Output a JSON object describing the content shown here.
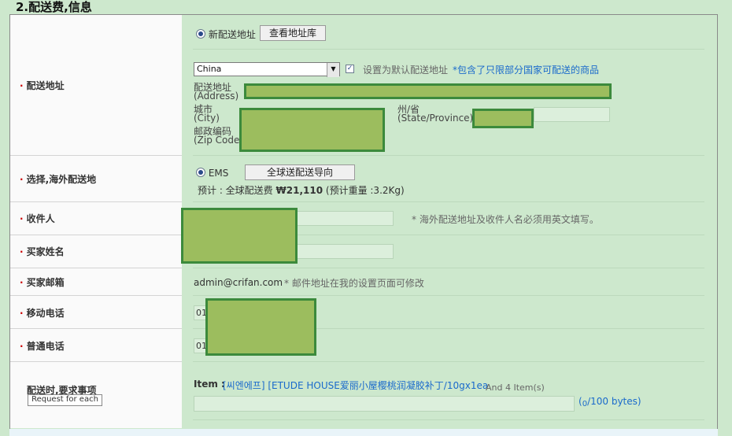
{
  "section_title": "2.配送费,信息",
  "rows": {
    "address": {
      "label": "配送地址"
    },
    "overseas": {
      "label": "选择,海外配送地"
    },
    "recipient": {
      "label": "收件人"
    },
    "buyer_name": {
      "label": "买家姓名"
    },
    "buyer_email": {
      "label": "买家邮箱"
    },
    "mobile": {
      "label": "移动电话"
    },
    "phone": {
      "label": "普通电话"
    },
    "delivery_req": {
      "label": "配送时,要求事项",
      "button": "Request for each"
    }
  },
  "address": {
    "new_address_radio": "新配送地址",
    "view_address_book_button": "查看地址库",
    "country_select": "China",
    "set_default_label": "设置为默认配送地址",
    "country_note": "*包含了只限部分国家可配送的商品",
    "address_label_cn": "配送地址",
    "address_label_en": "(Address)",
    "city_label_cn": "城市",
    "city_label_en": "(City)",
    "state_label_cn": "州/省",
    "state_label_en": "(State/Province)",
    "zip_label_cn": "邮政编码",
    "zip_label_en": "(Zip Code)"
  },
  "overseas": {
    "ems_radio": "EMS",
    "guide_button": "全球送配送导向",
    "estimate_prefix": "预计 : 全球配送费",
    "estimate_amount": "₩21,110",
    "estimate_weight": "(预计重量 :3.2Kg)"
  },
  "recipient": {
    "note": "* 海外配送地址及收件人名必须用英文填写。"
  },
  "email": {
    "value": "admin@crifan.com",
    "note": "* 邮件地址在我的设置页面可修改"
  },
  "phones": {
    "mobile_prefix": "01",
    "phone_prefix": "01"
  },
  "delivery": {
    "item_label": "Item :",
    "item_link": "[씨엔에프] [ETUDE HOUSE爱丽小屋樱桃润凝胶补丁/10gx1ea",
    "item_more": "And 4 Item(s)",
    "byte_open": "(",
    "byte_count": "0",
    "byte_rest": "/100 bytes)"
  }
}
